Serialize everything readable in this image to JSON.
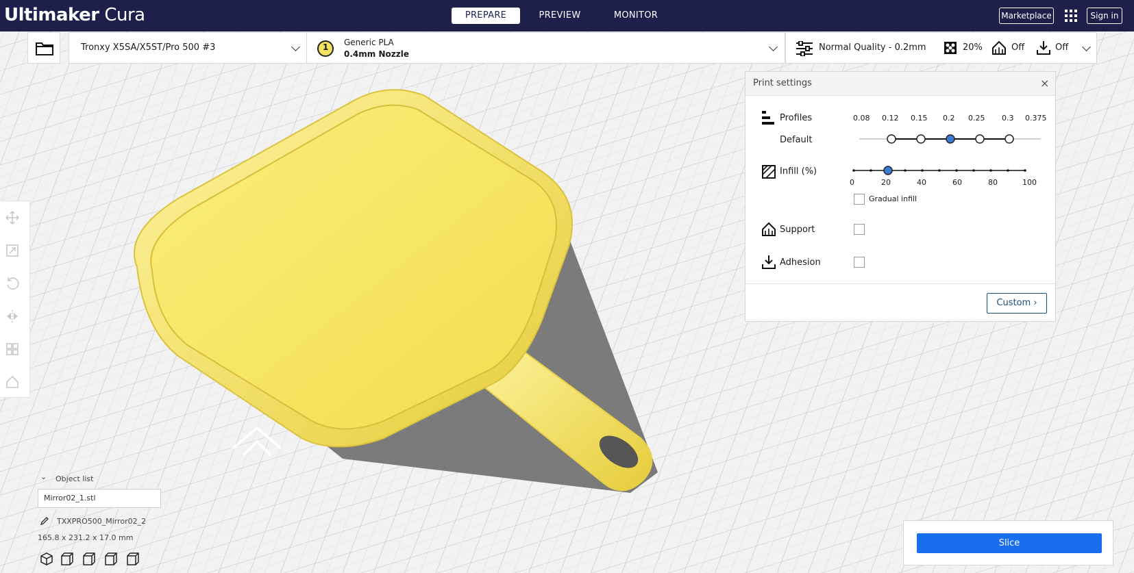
{
  "app": {
    "brand_bold": "Ultimaker",
    "brand_light": "Cura"
  },
  "header": {
    "tabs": [
      {
        "label": "PREPARE",
        "active": true
      },
      {
        "label": "PREVIEW",
        "active": false
      },
      {
        "label": "MONITOR",
        "active": false
      }
    ],
    "marketplace_label": "Marketplace",
    "sign_in_label": "Sign in"
  },
  "toolbar": {
    "printer_name": "Tronxy X5SA/X5ST/Pro 500 #3",
    "extruder_number": "1",
    "material_name": "Generic PLA",
    "nozzle": "0.4mm Nozzle",
    "quality": "Normal Quality - 0.2mm",
    "infill": "20%",
    "support": "Off",
    "adhesion": "Off"
  },
  "print_settings": {
    "title": "Print settings",
    "close_label": "×",
    "profiles_label": "Profiles",
    "default_label": "Default",
    "layer_heights": [
      "0.08",
      "0.12",
      "0.15",
      "0.2",
      "0.25",
      "0.3",
      "0.375"
    ],
    "selected_layer_height": "0.2",
    "infill_label": "Infill (%)",
    "infill_ticks": [
      "0",
      "20",
      "40",
      "60",
      "80",
      "100"
    ],
    "infill_value": 20,
    "gradual_infill_label": "Gradual infill",
    "gradual_infill_checked": false,
    "support_label": "Support",
    "support_checked": false,
    "adhesion_label": "Adhesion",
    "adhesion_checked": false,
    "custom_label": "Custom"
  },
  "object_list": {
    "header": "Object list",
    "file_name": "Mirror02_1.stl",
    "job_name": "TXXPRO500_Mirror02_2",
    "dimensions": "165.8 x 231.2 x 17.0 mm"
  },
  "slice": {
    "label": "Slice"
  },
  "colors": {
    "header_bg": "#1e1f4b",
    "accent_blue": "#196ef0",
    "model_yellow": "#f5e45e",
    "slider_knob": "#3d7ad6"
  }
}
